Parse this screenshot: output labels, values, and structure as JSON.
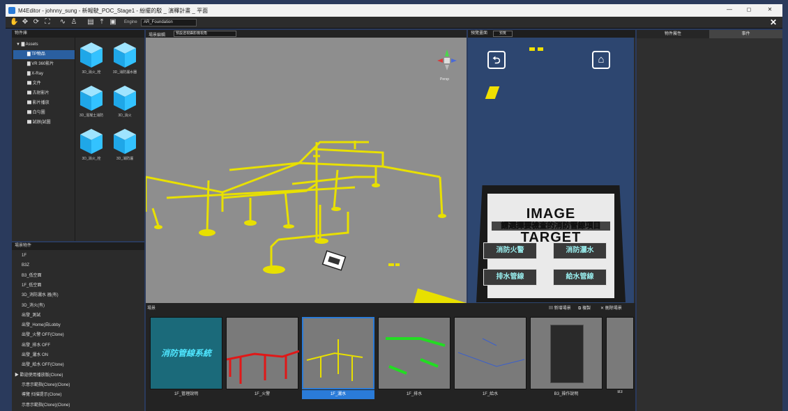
{
  "app": {
    "title": "M4Editor - johnny_sung - 新報駛_POC_Stage1 - 紛擺的駁 _ 演釋計畫 _ 平面"
  },
  "toolbar": {
    "engine_label": "Engine",
    "engine_value": "AR_Foundation",
    "close_glyph": "✕"
  },
  "window_controls": {
    "minimize": "—",
    "maximize": "◻",
    "close": "✕"
  },
  "assets": {
    "header": "物件庫",
    "root": "Assets",
    "folders": [
      "TP物品",
      "VR 360影片",
      "X-Ray",
      "文件",
      "古射影片",
      "影片播放",
      "白勻圖",
      "試辦(試圖"
    ],
    "selected_folder": 0,
    "items": [
      "3D_消火_栓",
      "3D_消防灑水器",
      "3D_混凝土消防",
      "3D_消火",
      "3D_消火_栓",
      "3D_消防灑"
    ]
  },
  "scene_tree": {
    "header": "場景物件",
    "items": [
      "1F",
      "B3Z",
      "B3_低空面",
      "1F_低空面",
      "3D_消防灑水 器(有)",
      "3D_消火(有)",
      "出發_測試",
      "出發_Home(自Lobby",
      "出發_火警 OFF(Clone)",
      "出發_排水 OFF",
      "出發_灑水 ON",
      "出發_給水 OFF(Clone)",
      "▶ 歡迎使用播放版(Clone)",
      "示意示範指(Clone)(Clone)",
      "導覽 扫描提示(Clone)",
      "示意示範指(Clone)(Clone)"
    ]
  },
  "viewport": {
    "header": "場景編輯",
    "camera_value": "預設透視攝影機視角",
    "gizmo_label": "Persp"
  },
  "phone": {
    "header": "預覽畫面",
    "header_value": "預覽",
    "target_line1": "IMAGE",
    "target_line2": "TARGET",
    "prompt": "請選擇要檢查的消防管線項目",
    "buttons": [
      "消防火警",
      "消防灑水",
      "排水管線",
      "給水管線"
    ],
    "back_glyph": "⮌",
    "home_glyph": "⌂"
  },
  "right_panel": {
    "tabs": [
      "物件屬性",
      "事件"
    ]
  },
  "scenes": {
    "header": "場景",
    "actions": [
      "新增場景",
      "複製",
      "刪除場景"
    ],
    "thumbs": [
      "1F_管理說明",
      "1F_火警",
      "1F_灑水",
      "1F_排水",
      "1F_給水",
      "B3_操作說明",
      "B3"
    ],
    "selected": 2,
    "thumb0_text": "消防管線系統"
  },
  "colors": {
    "accent": "#2a7bd8",
    "pipe": "#e8e000",
    "ar_bg": "#2d4670",
    "thumb_fire": "#e01818",
    "thumb_drain": "#22dd22"
  }
}
